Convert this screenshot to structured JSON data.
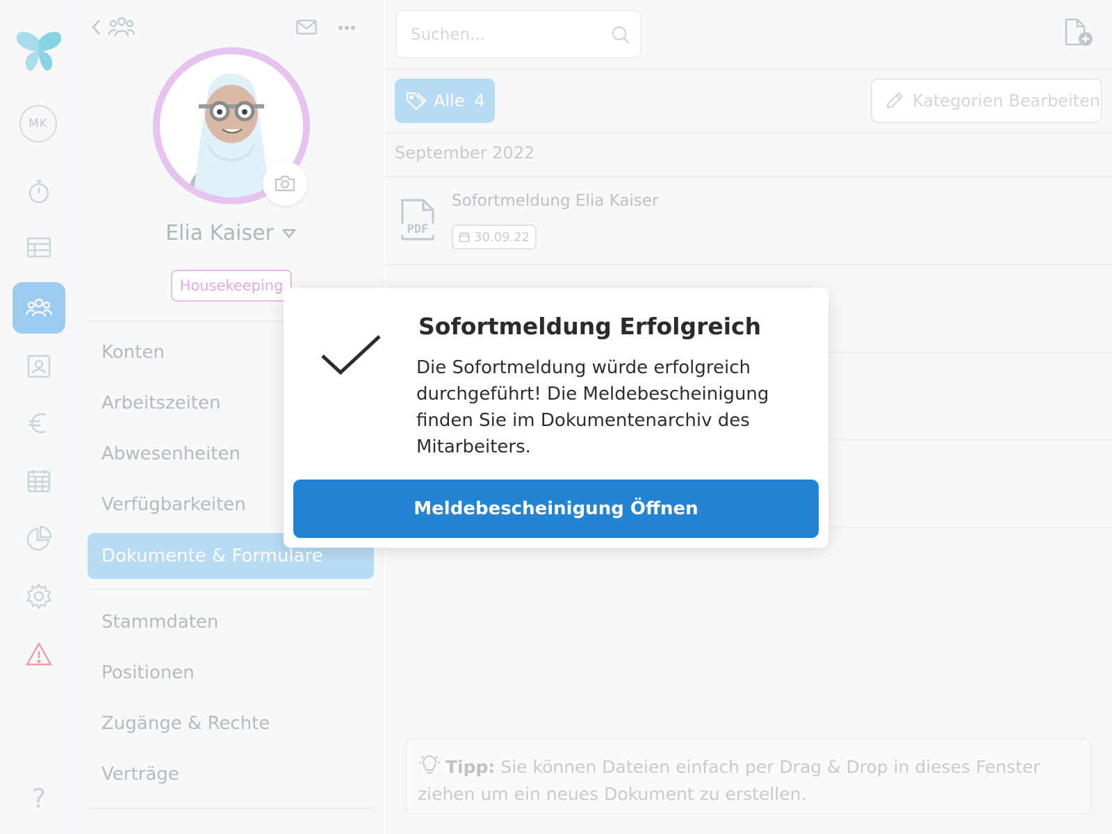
{
  "rail": {
    "user_initials": "MK",
    "icons": [
      "timer-icon",
      "table-icon",
      "team-icon",
      "contact-card-icon",
      "euro-icon",
      "calendar-icon",
      "pie-chart-icon",
      "settings-icon",
      "warning-icon",
      "help-icon"
    ],
    "active": "team-icon",
    "help_label": "?"
  },
  "profile": {
    "name": "Elia Kaiser",
    "department_tag": "Housekeeping",
    "menu": [
      {
        "label": "Konten"
      },
      {
        "label": "Arbeitszeiten"
      },
      {
        "label": "Abwesenheiten"
      },
      {
        "label": "Verfügbarkeiten"
      },
      {
        "label": "Dokumente & Formulare",
        "active": true
      },
      {
        "label": "Stammdaten"
      },
      {
        "label": "Positionen"
      },
      {
        "label": "Zugänge & Rechte"
      },
      {
        "label": "Verträge"
      }
    ]
  },
  "main": {
    "search_placeholder": "Suchen...",
    "filter_all": {
      "label": "Alle",
      "count": "4"
    },
    "edit_categories": "Kategorien Bearbeiten",
    "month": "September 2022",
    "documents": [
      {
        "type": "PDF",
        "title": "Sofortmeldung Elia Kaiser",
        "date": "30.09.22"
      }
    ],
    "tip": {
      "label": "Tipp:",
      "text": " Sie können Dateien einfach per Drag & Drop in dieses Fenster ziehen um ein neues Dokument zu erstellen."
    }
  },
  "modal": {
    "title": "Sofortmeldung Erfolgreich",
    "message": "Die Sofortmeldung würde erfolgreich durchgeführt! Die Meldebescheinigung finden Sie im Dokumentenarchiv des Mitarbeiters.",
    "button": "Meldebescheinigung Öffnen"
  },
  "colors": {
    "accent": "#2384d3",
    "active_nav": "#9ccbef",
    "tag": "#e4a7ea",
    "warning": "#f29aa2"
  }
}
